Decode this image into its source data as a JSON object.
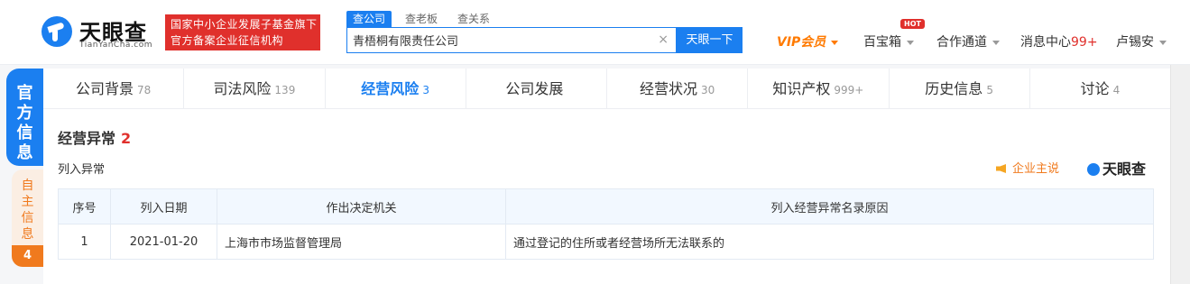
{
  "header": {
    "logo": {
      "name": "天眼查",
      "sub": "TianYanCha.com"
    },
    "gov_badge": {
      "line1": "国家中小企业发展子基金旗下",
      "line2": "官方备案企业征信机构"
    },
    "search": {
      "tabs": [
        "查公司",
        "查老板",
        "查关系"
      ],
      "value": "青梧桐有限责任公司",
      "clear": "×",
      "button": "天眼一下"
    },
    "vip": "VIP会员",
    "toolbox": "百宝箱",
    "hot": "HOT",
    "partner": "合作通道",
    "messages": {
      "label": "消息中心",
      "count": "99+"
    },
    "user": "卢锡安"
  },
  "side": {
    "official": [
      "官",
      "方",
      "信",
      "息"
    ],
    "self": [
      "自",
      "主",
      "信",
      "息"
    ],
    "self_count": "4"
  },
  "tabs": [
    {
      "label": "公司背景",
      "count": "78"
    },
    {
      "label": "司法风险",
      "count": "139"
    },
    {
      "label": "经营风险",
      "count": "3"
    },
    {
      "label": "公司发展",
      "count": ""
    },
    {
      "label": "经营状况",
      "count": "30"
    },
    {
      "label": "知识产权",
      "count": "999+"
    },
    {
      "label": "历史信息",
      "count": "5"
    },
    {
      "label": "讨论",
      "count": "4"
    }
  ],
  "section": {
    "title": "经营异常",
    "count": "2",
    "subtitle": "列入异常",
    "company_says": "企业主说",
    "brand": "天眼查"
  },
  "table": {
    "headers": [
      "序号",
      "列入日期",
      "作出决定机关",
      "列入经营异常名录原因"
    ],
    "rows": [
      [
        "1",
        "2021-01-20",
        "上海市市场监督管理局",
        "通过登记的住所或者经营场所无法联系的"
      ]
    ]
  },
  "colors": {
    "primary": "#1b7ff0",
    "danger": "#e0302c",
    "vip": "#ff7a00",
    "self_info": "#f07a1e"
  }
}
